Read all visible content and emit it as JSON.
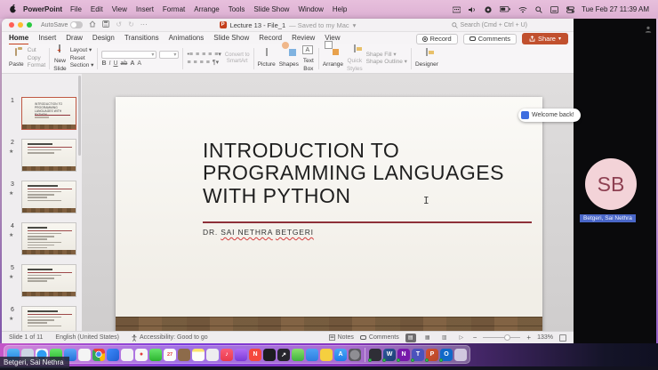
{
  "menu_bar": {
    "app_name": "PowerPoint",
    "items": [
      "File",
      "Edit",
      "View",
      "Insert",
      "Format",
      "Arrange",
      "Tools",
      "Slide Show",
      "Window",
      "Help"
    ],
    "status_icon_names": [
      "grid-icon",
      "volume-icon",
      "record-app-icon",
      "battery-icon",
      "wifi-icon",
      "search-icon",
      "input-menu-icon",
      "control-center-icon"
    ],
    "datetime": "Tue Feb 27  11:39 AM"
  },
  "title_bar": {
    "autosave_label": "AutoSave",
    "doc_title": "Lecture 13 - File_1",
    "save_status": "— Saved to my Mac",
    "chevron": "▾",
    "overflow": "···",
    "undo": "↺",
    "redo": "↻",
    "search_label": "Search (Cmd + Ctrl + U)"
  },
  "ribbon": {
    "tabs": [
      "Home",
      "Insert",
      "Draw",
      "Design",
      "Transitions",
      "Animations",
      "Slide Show",
      "Record",
      "Review",
      "View"
    ],
    "active_tab": "Home",
    "record_label": "Record",
    "comments_label": "Comments",
    "share_label": "Share",
    "paste": "Paste",
    "cut": "Cut",
    "copy": "Copy",
    "format": "Format",
    "new_slide_1": "New",
    "new_slide_2": "Slide",
    "layout": "Layout ▾",
    "reset": "Reset",
    "section": "Section ▾",
    "font_buttons": [
      {
        "label": "B",
        "style": "b"
      },
      {
        "label": "I",
        "style": "i"
      },
      {
        "label": "U",
        "style": "u"
      },
      {
        "label": "ab",
        "style": "s"
      },
      {
        "label": "A",
        "style": "b"
      },
      {
        "label": "A",
        "style": ""
      }
    ],
    "para_buttons_row1": [
      "•≡",
      "≡",
      "≡",
      "≡",
      "≡▾"
    ],
    "para_buttons_row2": [
      "≡",
      "≡",
      "≡",
      "≡",
      "¶▾"
    ],
    "convert_smartart_1": "Convert to",
    "convert_smartart_2": "SmartArt",
    "picture": "Picture",
    "shapes": "Shapes",
    "text_box_1": "Text",
    "text_box_2": "Box",
    "arrange": "Arrange",
    "quick_styles_1": "Quick",
    "quick_styles_2": "Styles",
    "shape_fill": "Shape Fill ▾",
    "shape_outline": "Shape Outline ▾",
    "designer": "Designer"
  },
  "slide_panel": {
    "slides": [
      {
        "number": "1",
        "selected": true,
        "starred": false,
        "type": "title"
      },
      {
        "number": "2",
        "selected": false,
        "starred": true,
        "type": "content",
        "bars": 2
      },
      {
        "number": "3",
        "selected": false,
        "starred": true,
        "type": "content",
        "bars": 4
      },
      {
        "number": "4",
        "selected": false,
        "starred": true,
        "type": "content",
        "bars": 6
      },
      {
        "number": "5",
        "selected": false,
        "starred": true,
        "type": "content",
        "bars": 3
      },
      {
        "number": "6",
        "selected": false,
        "starred": true,
        "type": "content",
        "bars": 4
      }
    ]
  },
  "slide": {
    "title": "INTRODUCTION TO PROGRAMMING LANGUAGES WITH PYTHON",
    "author_prefix": "DR. ",
    "author_name_1": "SAI NETHRA",
    "author_name_2": "BETGERI"
  },
  "notification": {
    "text": "Welcome back!"
  },
  "participant": {
    "initials": "SB",
    "name": "Betgeri, Sai Nethra"
  },
  "presenter_overlay": {
    "name": "Betgeri, Sai Nethra"
  },
  "status_bar": {
    "slide_info": "Slide 1 of 11",
    "language": "English (United States)",
    "accessibility": "Accessibility: Good to go",
    "notes_label": "Notes",
    "comments_label": "Comments",
    "zoom_level": "133%"
  },
  "dock": {
    "items": [
      {
        "name": "finder",
        "bg": "linear-gradient(180deg,#59b7f5,#1e7fe0)"
      },
      {
        "name": "launchpad",
        "bg": "#cdd6e4"
      },
      {
        "name": "safari",
        "bg": "radial-gradient(circle,#2f9df2 55%,#f2f4f7 56%)"
      },
      {
        "name": "messages",
        "bg": "linear-gradient(180deg,#67e56a,#27b32b)"
      },
      {
        "name": "mail",
        "bg": "linear-gradient(180deg,#5aa7f7,#2470d8)"
      },
      {
        "name": "photos",
        "bg": "#f4f4f4"
      },
      {
        "name": "chrome",
        "bg": "radial-gradient(circle at 50% 45%,#4285f4 0 26%,#fff 27% 34%,rgba(0,0,0,0) 35%),conic-gradient(from -45deg,#ea4335 0 120deg,#fbbc05 0 210deg,#34a853 0)"
      },
      {
        "name": "shortcuts",
        "bg": "linear-gradient(135deg,#3d8bfd,#1f5fd0)"
      },
      {
        "name": "preview",
        "bg": "#f2f2f4"
      },
      {
        "name": "maps",
        "bg": "#f6f6f6",
        "glyph": "●",
        "glyph_color": "#e23b3b"
      },
      {
        "name": "facetime",
        "bg": "linear-gradient(180deg,#68e66d,#2cb52f)"
      },
      {
        "name": "calendar",
        "bg": "#fbfbfb",
        "glyph": "27",
        "glyph_color": "#e23b3b"
      },
      {
        "name": "downloads-folder",
        "bg": "#8d6b4a"
      },
      {
        "name": "notes",
        "bg": "linear-gradient(180deg,#fbe36a 25%,#fdfdf8 25%)"
      },
      {
        "name": "reminders",
        "bg": "#ededef"
      },
      {
        "name": "music",
        "bg": "linear-gradient(180deg,#fb5c74,#e93a4d)",
        "glyph": "♪",
        "glyph_color": "#ffffff"
      },
      {
        "name": "podcasts",
        "bg": "linear-gradient(180deg,#b06cf5,#7b3bd8)"
      },
      {
        "name": "news",
        "bg": "#f5493d",
        "glyph": "N",
        "glyph_color": "#ffffff"
      },
      {
        "name": "tv",
        "bg": "#1d1d20"
      },
      {
        "name": "stocks",
        "bg": "#26262c",
        "glyph": "↗",
        "glyph_color": "#ffffff"
      },
      {
        "name": "numbers",
        "bg": "linear-gradient(180deg,#8ae06b,#3fb33f)"
      },
      {
        "name": "keynote",
        "bg": "linear-gradient(180deg,#4da2f5,#2e7de0)"
      },
      {
        "name": "pencil-app",
        "bg": "#f5cf3f"
      },
      {
        "name": "app-store",
        "bg": "linear-gradient(180deg,#4aa8f5,#1f7ce8)",
        "glyph": "A",
        "glyph_color": "#ffffff"
      },
      {
        "name": "system-settings",
        "bg": "radial-gradient(circle,#8e8e93 55%,#5a5a5e 56%)"
      },
      {
        "name": "divider",
        "divider": true
      },
      {
        "name": "terminal",
        "bg": "#2e2e36",
        "badge": true
      },
      {
        "name": "word",
        "bg": "linear-gradient(135deg,#2b579a,#1e3f73)",
        "glyph": "W",
        "glyph_color": "#ffffff",
        "badge": true
      },
      {
        "name": "onenote",
        "bg": "#7719aa",
        "glyph": "N",
        "glyph_color": "#ffffff",
        "badge": true
      },
      {
        "name": "teams",
        "bg": "#4b53bc",
        "glyph": "T",
        "glyph_color": "#ffffff",
        "badge": true
      },
      {
        "name": "powerpoint",
        "bg": "linear-gradient(135deg,#d35230,#b7472a)",
        "glyph": "P",
        "glyph_color": "#ffffff",
        "badge": true
      },
      {
        "name": "outlook",
        "bg": "#1269c8",
        "glyph": "O",
        "glyph_color": "#ffffff",
        "badge": true
      },
      {
        "name": "trash",
        "bg": "rgba(235,235,245,.75)"
      }
    ]
  },
  "colors": {
    "accent_orange": "#c1502e",
    "menubar_pink": "#e3bada",
    "title_rule_maroon": "#8e3038",
    "avatar_pink": "#f3d3d8",
    "avatar_text": "#8e4052",
    "name_tag_blue": "#4a67c8",
    "active_tab_underline": "#c43e1c"
  }
}
